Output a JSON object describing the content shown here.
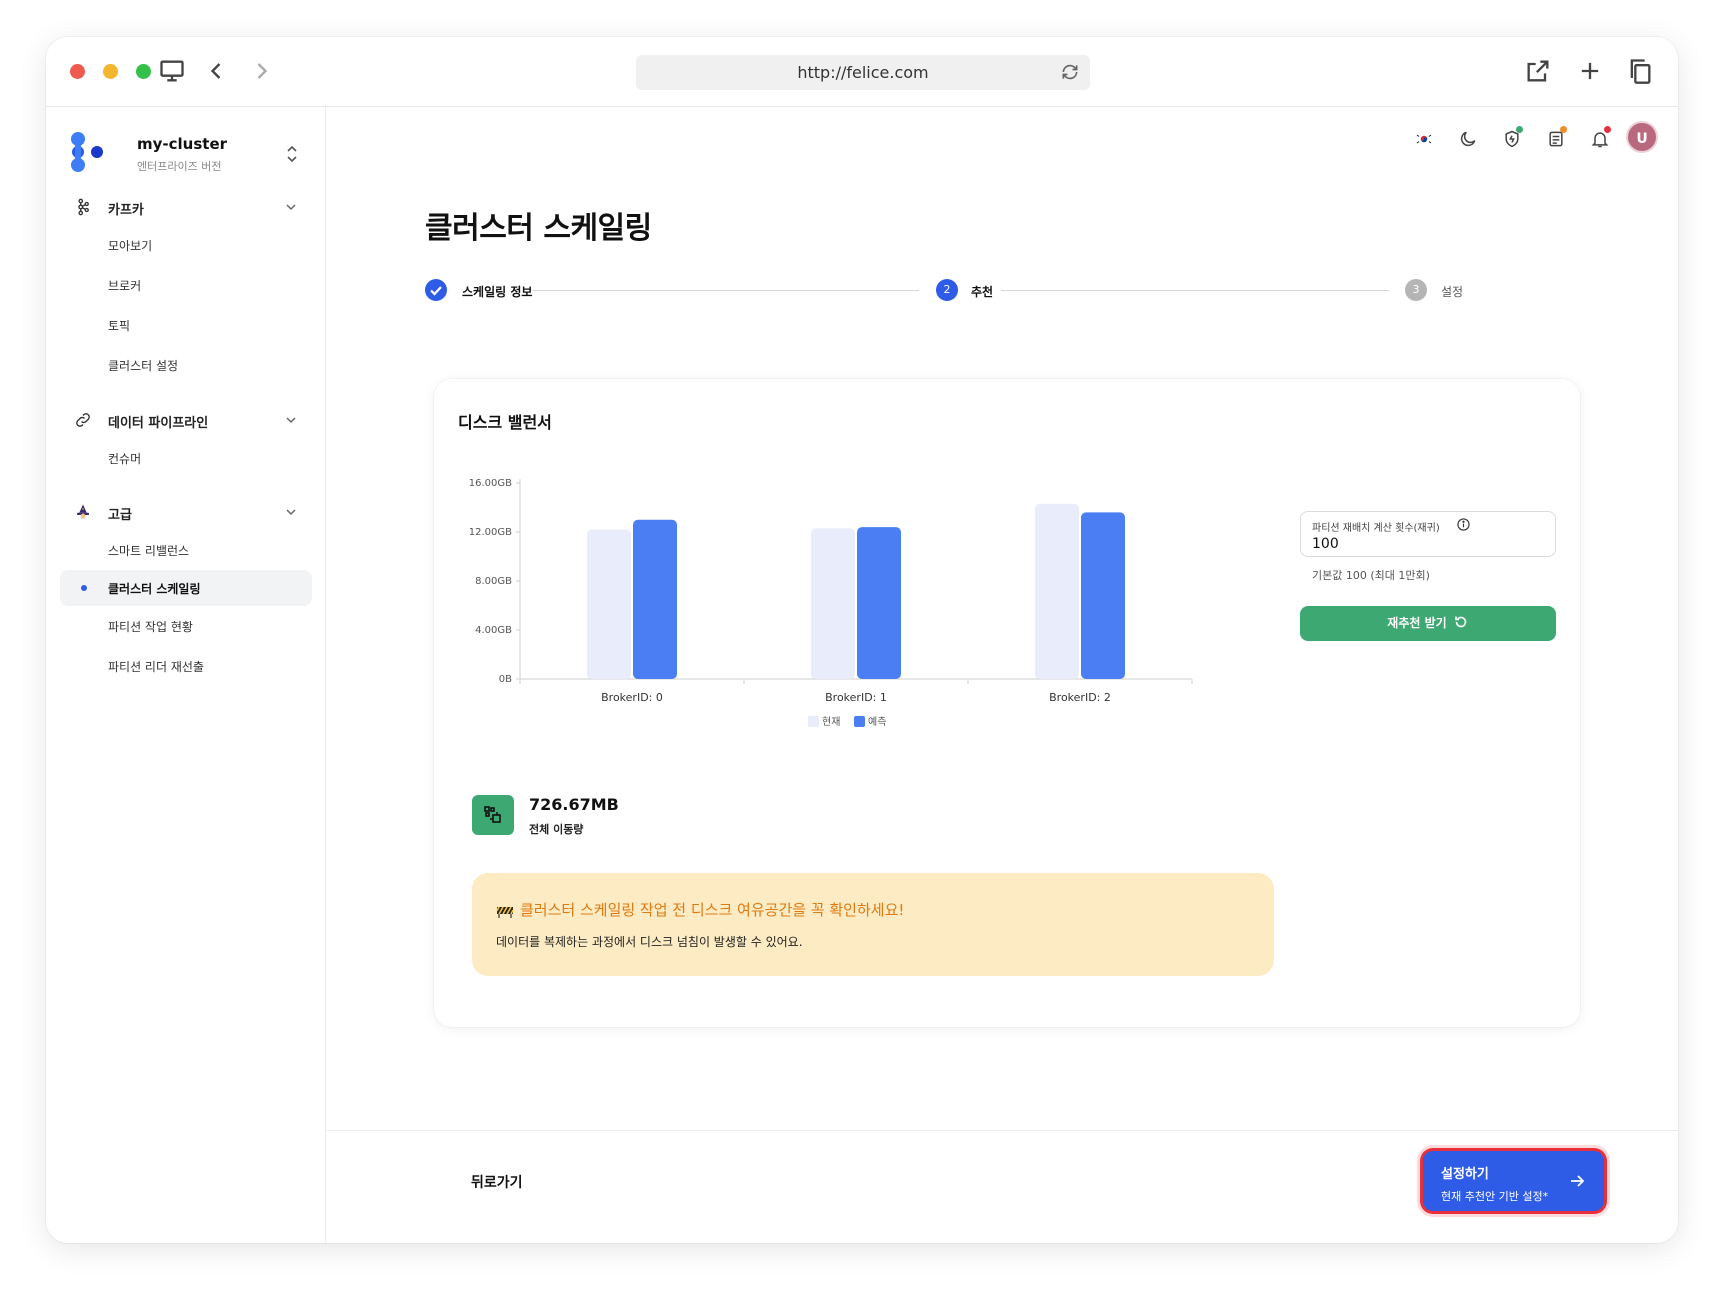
{
  "browser": {
    "url": "http://felice.com"
  },
  "sidebar": {
    "cluster_name": "my-cluster",
    "cluster_edition": "엔터프라이즈 버전",
    "groups": [
      {
        "label": "카프카",
        "icon": "kafka-icon",
        "items": [
          "모아보기",
          "브로커",
          "토픽",
          "클러스터 설정"
        ]
      },
      {
        "label": "데이터 파이프라인",
        "icon": "link-icon",
        "items": [
          "컨슈머"
        ]
      },
      {
        "label": "고급",
        "icon": "wizard-icon",
        "items": [
          "스마트 리밸런스",
          "클러스터 스케일링",
          "파티션 작업 현황",
          "파티션 리더 재선출"
        ]
      }
    ],
    "active_item": "클러스터 스케일링"
  },
  "header": {
    "avatar_initial": "U",
    "icons": [
      "korea-flag-icon",
      "moon-icon",
      "shield-icon",
      "notes-icon",
      "bell-icon"
    ]
  },
  "page": {
    "title": "클러스터 스케일링"
  },
  "stepper": {
    "steps": [
      {
        "number": "1",
        "label": "스케일링 정보",
        "state": "done"
      },
      {
        "number": "2",
        "label": "추천",
        "state": "current"
      },
      {
        "number": "3",
        "label": "설정",
        "state": "pending"
      }
    ]
  },
  "card": {
    "title": "디스크 밸런서",
    "partition_field": {
      "label": "파티션 재배치 계산 횟수(재귀)",
      "value": "100",
      "hint": "기본값 100 (최대 1만회)"
    },
    "recommend_button": "재추천 받기",
    "movement": {
      "value": "726.67MB",
      "label": "전체 이동량"
    },
    "warning": {
      "icon": "🚧",
      "title": "클러스터 스케일링 작업 전 디스크 여유공간을 꼭 확인하세요!",
      "text": "데이터를 복제하는 과정에서 디스크 넘침이 발생할 수 있어요."
    }
  },
  "chart_data": {
    "type": "bar",
    "categories": [
      "BrokerID: 0",
      "BrokerID: 1",
      "BrokerID: 2"
    ],
    "series": [
      {
        "name": "현재",
        "values": [
          12.2,
          12.3,
          14.3
        ],
        "color": "#e8ecfb"
      },
      {
        "name": "예측",
        "values": [
          13.0,
          12.4,
          13.6
        ],
        "color": "#4a7ef2"
      }
    ],
    "y_ticks": [
      "0B",
      "4.00GB",
      "8.00GB",
      "12.00GB",
      "16.00GB"
    ],
    "ylim": [
      0,
      16
    ],
    "unit": "GB",
    "legend_position": "bottom-center"
  },
  "footer": {
    "back_label": "뒤로가기",
    "cta_title": "설정하기",
    "cta_sub": "현재 추천안 기반 설정*"
  }
}
